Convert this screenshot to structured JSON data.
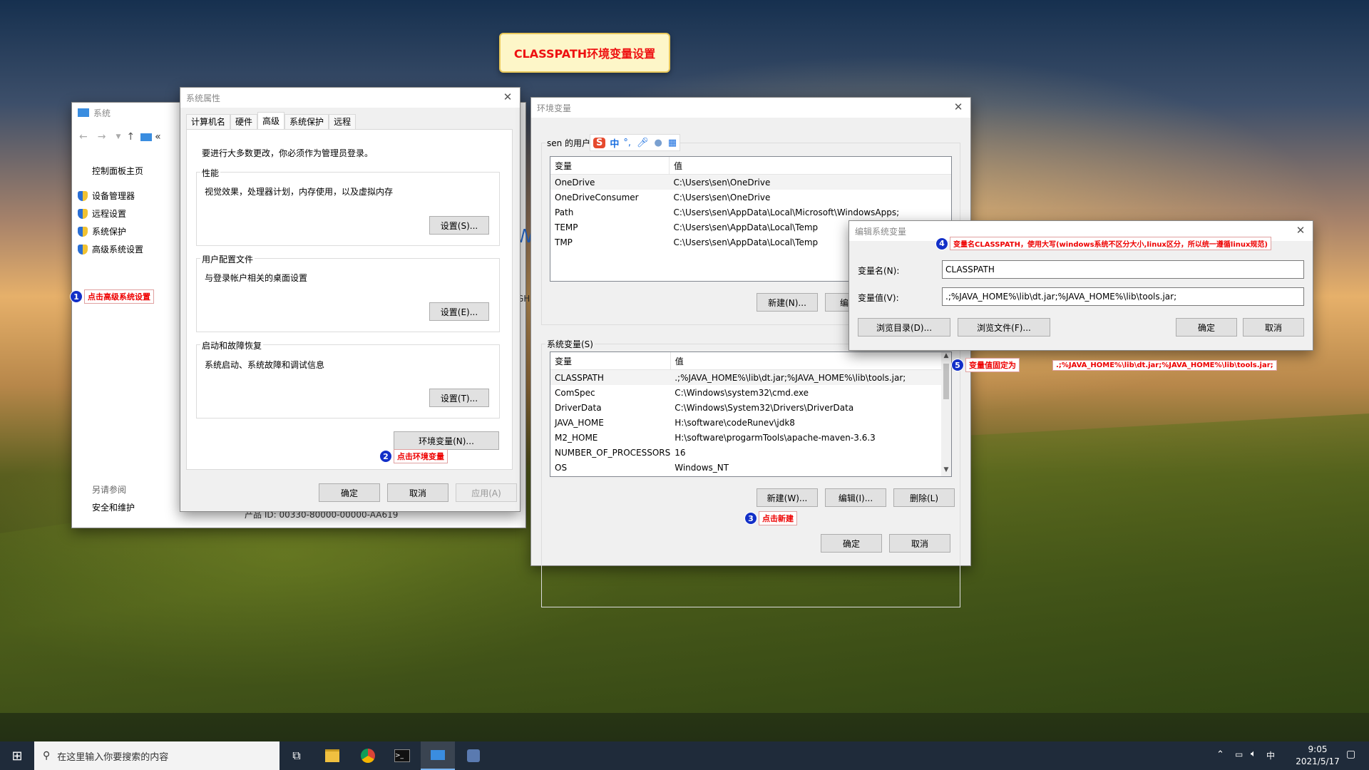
{
  "banner": {
    "title": "CLASSPATH环境变量设置"
  },
  "system_window": {
    "title": "系统",
    "addr_chevron": "«",
    "control_panel_home": "控制面板主页",
    "nav_items": [
      "设备管理器",
      "远程设置",
      "系统保护",
      "高级系统设置"
    ],
    "see_also": "另请参阅",
    "security": "安全和维护",
    "product_id": "产品 ID: 00330-80000-00000-AA619",
    "partial_text_1": "W",
    "partial_text_2": "GH"
  },
  "sysprops": {
    "title": "系统属性",
    "tabs": [
      "计算机名",
      "硬件",
      "高级",
      "系统保护",
      "远程"
    ],
    "admin_note": "要进行大多数更改，你必须作为管理员登录。",
    "perf": {
      "label": "性能",
      "text": "视觉效果，处理器计划，内存使用，以及虚拟内存",
      "button": "设置(S)..."
    },
    "profile": {
      "label": "用户配置文件",
      "text": "与登录帐户相关的桌面设置",
      "button": "设置(E)..."
    },
    "startup": {
      "label": "启动和故障恢复",
      "text": "系统启动、系统故障和调试信息",
      "button": "设置(T)..."
    },
    "env_button": "环境变量(N)...",
    "ok": "确定",
    "cancel": "取消",
    "apply": "应用(A)"
  },
  "envvars": {
    "title": "环境变量",
    "user_label": "sen 的用户变量",
    "col_var": "变量",
    "col_val": "值",
    "user_vars": [
      {
        "name": "OneDrive",
        "value": "C:\\Users\\sen\\OneDrive"
      },
      {
        "name": "OneDriveConsumer",
        "value": "C:\\Users\\sen\\OneDrive"
      },
      {
        "name": "Path",
        "value": "C:\\Users\\sen\\AppData\\Local\\Microsoft\\WindowsApps;"
      },
      {
        "name": "TEMP",
        "value": "C:\\Users\\sen\\AppData\\Local\\Temp"
      },
      {
        "name": "TMP",
        "value": "C:\\Users\\sen\\AppData\\Local\\Temp"
      }
    ],
    "user_new": "新建(N)...",
    "user_edit": "编",
    "sys_label": "系统变量(S)",
    "sys_vars": [
      {
        "name": "CLASSPATH",
        "value": ".;%JAVA_HOME%\\lib\\dt.jar;%JAVA_HOME%\\lib\\tools.jar;"
      },
      {
        "name": "ComSpec",
        "value": "C:\\Windows\\system32\\cmd.exe"
      },
      {
        "name": "DriverData",
        "value": "C:\\Windows\\System32\\Drivers\\DriverData"
      },
      {
        "name": "JAVA_HOME",
        "value": "H:\\software\\codeRunev\\jdk8"
      },
      {
        "name": "M2_HOME",
        "value": "H:\\software\\progarmTools\\apache-maven-3.6.3"
      },
      {
        "name": "NUMBER_OF_PROCESSORS",
        "value": "16"
      },
      {
        "name": "OS",
        "value": "Windows_NT"
      }
    ],
    "sys_new": "新建(W)...",
    "sys_edit": "编辑(I)...",
    "sys_delete": "删除(L)",
    "ok": "确定",
    "cancel": "取消"
  },
  "ime": {
    "logo": "S",
    "lang": "中",
    "punct": "°,"
  },
  "editvar": {
    "title": "编辑系统变量",
    "name_label": "变量名(N):",
    "name_value": "CLASSPATH",
    "value_label": "变量值(V):",
    "value_value": ".;%JAVA_HOME%\\lib\\dt.jar;%JAVA_HOME%\\lib\\tools.jar;",
    "browse_dir": "浏览目录(D)...",
    "browse_file": "浏览文件(F)...",
    "ok": "确定",
    "cancel": "取消"
  },
  "annotations": [
    {
      "num": "1",
      "text": "点击高级系统设置"
    },
    {
      "num": "2",
      "text": "点击环境变量"
    },
    {
      "num": "3",
      "text": "点击新建"
    },
    {
      "num": "4",
      "text": "变量名CLASSPATH，使用大写(windows系统不区分大小,linux区分，所以统一遵循linux规范)"
    },
    {
      "num": "5",
      "text": "变量值固定为",
      "value": ".;%JAVA_HOME%\\lib\\dt.jar;%JAVA_HOME%\\lib\\tools.jar;"
    }
  ],
  "taskbar": {
    "search_placeholder": "在这里输入你要搜索的内容",
    "time": "9:05",
    "date": "2021/5/17",
    "lang": "中"
  }
}
